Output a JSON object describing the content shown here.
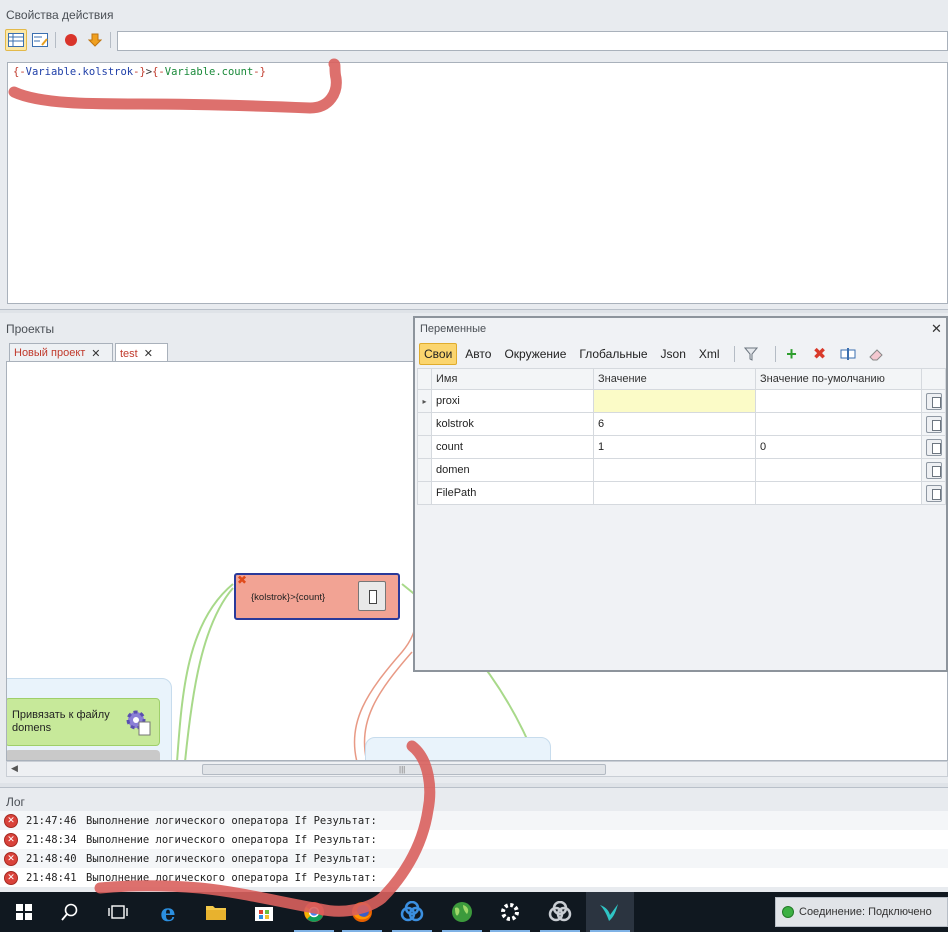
{
  "props": {
    "title": "Свойства действия",
    "expression": {
      "p1": "{-",
      "p2": "Variable.kolstrok",
      "p3": "-}",
      "p4": ">",
      "p5": "{-",
      "p6": "Variable.count",
      "p7": "-}"
    }
  },
  "projects": {
    "title": "Проекты",
    "tabs": [
      {
        "label": "Новый проект"
      },
      {
        "label": "test"
      }
    ],
    "if_node_label": "{kolstrok}>{count}",
    "green_node_label_line1": "Привязать к файлу",
    "green_node_label_line2": "domens"
  },
  "variables": {
    "title": "Переменные",
    "tabs": [
      "Свои",
      "Авто",
      "Окружение",
      "Глобальные",
      "Json",
      "Xml"
    ],
    "columns": [
      "Имя",
      "Значение",
      "Значение по-умолчанию"
    ],
    "rows": [
      {
        "name": "proxi",
        "value": "",
        "default": ""
      },
      {
        "name": "kolstrok",
        "value": "6",
        "default": ""
      },
      {
        "name": "count",
        "value": "1",
        "default": "0"
      },
      {
        "name": "domen",
        "value": "",
        "default": ""
      },
      {
        "name": "FilePath",
        "value": "",
        "default": ""
      }
    ],
    "row_marker": "▸"
  },
  "log": {
    "title": "Лог",
    "rows": [
      {
        "time": "21:47:46",
        "text": "Выполнение логического оператора If Результат:"
      },
      {
        "time": "21:48:34",
        "text": "Выполнение логического оператора If Результат:"
      },
      {
        "time": "21:48:40",
        "text": "Выполнение логического оператора If Результат:"
      },
      {
        "time": "21:48:41",
        "text": "Выполнение логического оператора If Результат:"
      }
    ]
  },
  "status": {
    "text": "Соединение: Подключено"
  },
  "colors": {
    "accent": "#fbd56e",
    "node_if": "#f2a394",
    "node_green": "#c7e99a",
    "error": "#d9423a",
    "annotation": "#d9615d"
  }
}
